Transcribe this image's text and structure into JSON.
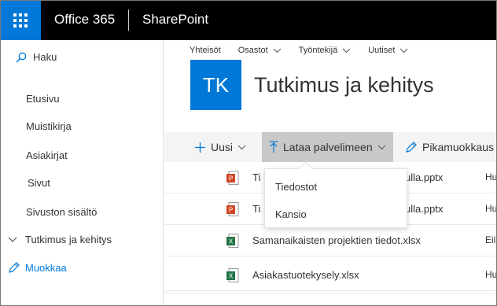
{
  "suite": {
    "title": "Office 365",
    "app": "SharePoint",
    "waffle_icon": "app-launcher-icon",
    "bg": "#000000",
    "accent": "#0078d7"
  },
  "leftnav": {
    "search_label": "Haku",
    "items": [
      {
        "label": "Etusivu"
      },
      {
        "label": "Muistikirja"
      },
      {
        "label": "Asiakirjat"
      },
      {
        "label": "Sivut"
      },
      {
        "label": "Sivuston sisältö"
      }
    ],
    "expandable": {
      "label": "Tutkimus ja kehitys",
      "icon": "chevron-down-icon"
    },
    "edit_label": "Muokkaa"
  },
  "hub": {
    "items": [
      {
        "label": "Yhteisöt",
        "has_chevron": false
      },
      {
        "label": "Osastot",
        "has_chevron": true
      },
      {
        "label": "Työntekijä",
        "has_chevron": true
      },
      {
        "label": "Uutiset",
        "has_chevron": true
      }
    ]
  },
  "site": {
    "logo_initials": "TK",
    "title": "Tutkimus ja kehitys"
  },
  "commandbar": {
    "new_label": "Uusi",
    "upload_label": "Lataa palvelimeen",
    "quickedit_label": "Pikamuokkaus"
  },
  "upload_menu": {
    "items": [
      "Tiedostot",
      "Kansio"
    ]
  },
  "files": [
    {
      "name_start": "Ti",
      "name_end": "ulla.pptx",
      "type": "pptx",
      "modified_by": "Hu"
    },
    {
      "name_start": "Ti",
      "name_end": "ulla.pptx",
      "type": "pptx",
      "modified_by": "Hu"
    },
    {
      "name": "Samanaikaisten projektien tiedot.xlsx",
      "type": "xlsx",
      "modified_by": "Eile"
    },
    {
      "name": "Asiakastuotekysely.xlsx",
      "type": "xlsx",
      "modified_by": "Hu"
    }
  ]
}
